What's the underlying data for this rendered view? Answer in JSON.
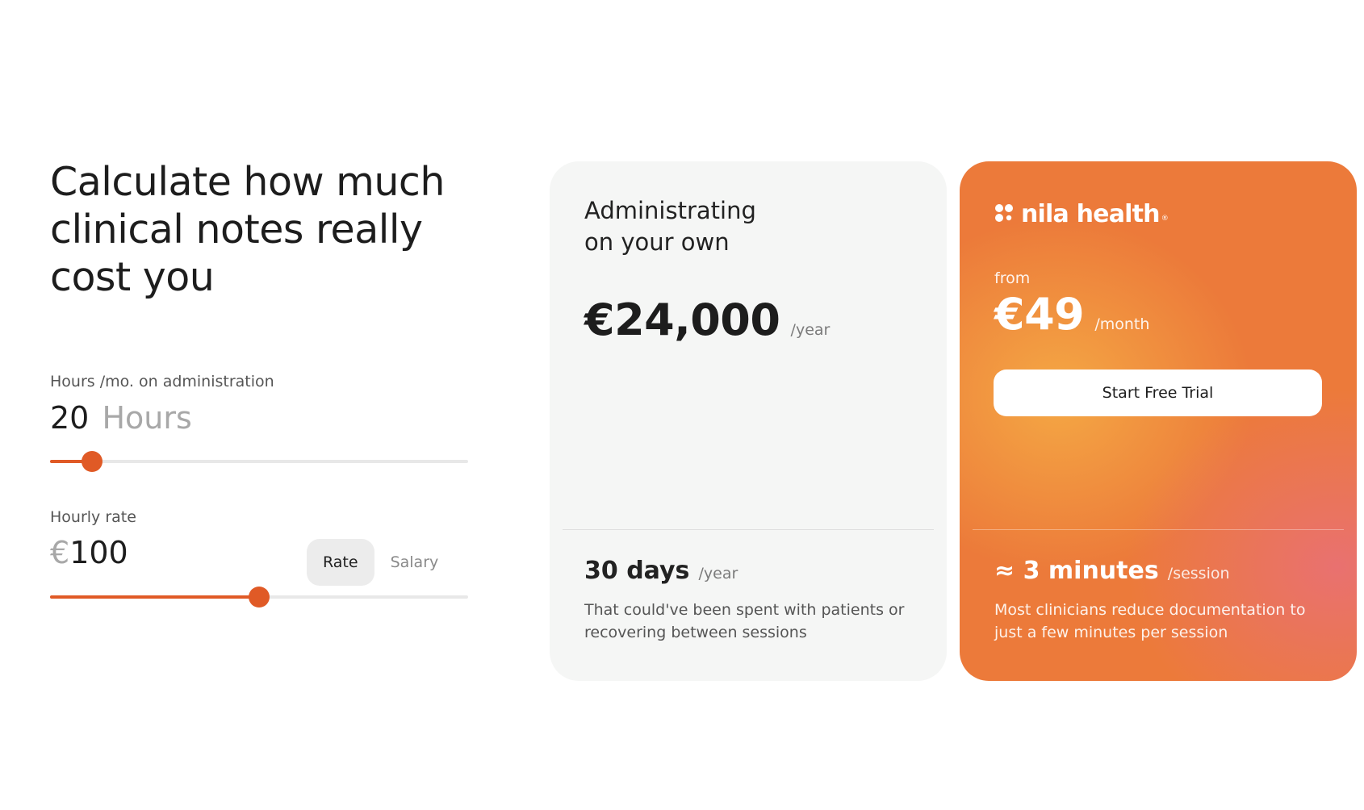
{
  "calculator": {
    "heading": "Calculate how much clinical notes really cost you",
    "hours": {
      "label": "Hours /mo. on administration",
      "value": "20",
      "unit": "Hours",
      "slider_fraction": 0.1
    },
    "rate": {
      "label": "Hourly rate",
      "currency": "€",
      "value": "100",
      "slider_fraction": 0.5,
      "toggle": {
        "options": [
          "Rate",
          "Salary"
        ],
        "selected": "Rate"
      }
    }
  },
  "own_card": {
    "title_line1": "Administrating",
    "title_line2": "on your own",
    "price": "€24,000",
    "price_period": "/year",
    "stat_value": "30 days",
    "stat_period": "/year",
    "stat_description": "That could've been spent with patients or recovering between sessions"
  },
  "nila_card": {
    "brand_name": "nila health",
    "brand_mark": "®",
    "from_label": "from",
    "price": "€49",
    "price_period": "/month",
    "cta_label": "Start Free Trial",
    "stat_value": "≈ 3 minutes",
    "stat_period": "/session",
    "stat_description": "Most clinicians reduce documentation to just a few minutes per session"
  },
  "colors": {
    "accent": "#e05a26",
    "card_neutral": "#f5f6f5",
    "card_brand": "#ec7a3a"
  }
}
